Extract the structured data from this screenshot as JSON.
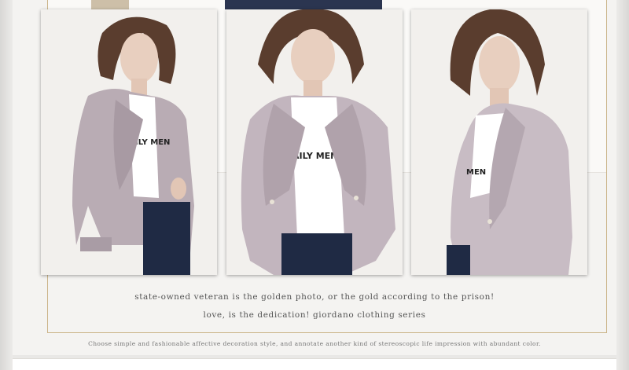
{
  "gallery": {
    "photos": [
      {
        "alt_icon": "model-photo-left",
        "print": "ILY MEN"
      },
      {
        "alt_icon": "model-photo-center",
        "print": "AILY MENI"
      },
      {
        "alt_icon": "model-photo-right",
        "print": "MEN"
      }
    ]
  },
  "captions": {
    "line1": "state-owned veteran is the golden photo, or the gold according to the prison!",
    "line2": "love, is the dedication! giordano clothing series",
    "footnote": "Choose simple and fashionable affective decoration style, and annotate another kind of stereoscopic life impression with abundant color."
  },
  "colors": {
    "frame_gold": "#cbb58a",
    "coat": "#b9acb4",
    "jeans": "#1f2a44"
  }
}
